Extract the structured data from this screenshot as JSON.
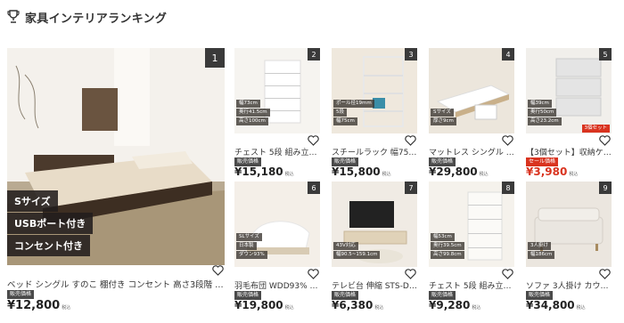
{
  "header": {
    "title": "家具インテリアランキング",
    "icon": "trophy-icon"
  },
  "colors": {
    "rank_bg": "#3a3a3a",
    "badge_bg": "#4a4a4a",
    "sale": "#d9331f"
  },
  "featured": {
    "rank": "1",
    "tags": [
      "Sサイズ",
      "USBポート付き",
      "コンセント付き"
    ],
    "title": "ベッド シングル すのこ 棚付き コンセント 高さ3段階 ウォル…",
    "badge": "販売価格",
    "price": "¥12,800",
    "tax": "税込"
  },
  "products": [
    {
      "rank": "2",
      "title": "チェスト 5段 組み立て簡…",
      "badge": "販売価格",
      "price": "¥15,180",
      "tax": "税込",
      "sale": false,
      "tags": [
        "幅73cm",
        "奥行41.5cm",
        "高さ100cm"
      ]
    },
    {
      "rank": "3",
      "title": "スチールラック 幅75cm S…",
      "badge": "販売価格",
      "price": "¥15,800",
      "tax": "税込",
      "sale": false,
      "tags": [
        "ポール径19mm",
        "5段",
        "幅75cm"
      ]
    },
    {
      "rank": "4",
      "title": "マットレス シングル エア…",
      "badge": "販売価格",
      "price": "¥29,800",
      "tax": "税込",
      "sale": false,
      "tags": [
        "Sサイズ",
        "厚さ9cm"
      ]
    },
    {
      "rank": "5",
      "title": "【3個セット】収納ケース …",
      "badge": "セール価格",
      "price": "¥3,980",
      "tax": "税込",
      "sale": true,
      "tags": [
        "幅39cm",
        "奥行50cm",
        "高さ23.2cm"
      ],
      "extra_tag": "3個セット"
    },
    {
      "rank": "6",
      "title": "羽毛布団 WDD93% 1.0kg…",
      "badge": "販売価格",
      "price": "¥19,800",
      "tax": "税込",
      "sale": false,
      "tags": [
        "SLサイズ",
        "日本製",
        "ダウン93%"
      ]
    },
    {
      "rank": "7",
      "title": "テレビ台 伸縮 STS-D90-…",
      "badge": "販売価格",
      "price": "¥6,380",
      "tax": "税込",
      "sale": false,
      "tags": [
        "43V対応",
        "幅90.5~159.1cm"
      ]
    },
    {
      "rank": "8",
      "title": "チェスト 5段 組み立て簡…",
      "badge": "販売価格",
      "price": "¥9,280",
      "tax": "税込",
      "sale": false,
      "tags": [
        "幅53cm",
        "奥行39.5cm",
        "高さ99.8cm"
      ]
    },
    {
      "rank": "9",
      "title": "ソファ 3人掛け カウチソ…",
      "badge": "販売価格",
      "price": "¥34,800",
      "tax": "税込",
      "sale": false,
      "tags": [
        "3人掛け",
        "幅186cm"
      ]
    }
  ]
}
